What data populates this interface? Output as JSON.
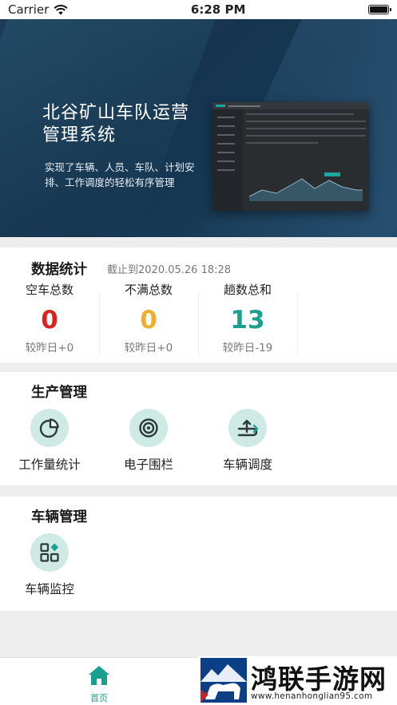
{
  "status_bar": {
    "carrier": "Carrier",
    "time": "6:28 PM"
  },
  "banner": {
    "title": "北谷矿山车队运营管理系统",
    "description": "实现了车辆、人员、车队、计划安排、工作调度的轻松有序管理"
  },
  "stats": {
    "title": "数据统计",
    "date": "截止到2020.05.26 18:28",
    "items": [
      {
        "label": "空车总数",
        "value": "0",
        "sub": "较昨日+0",
        "color": "#d9231f"
      },
      {
        "label": "不满总数",
        "value": "0",
        "sub": "较昨日+0",
        "color": "#f0ac2e"
      },
      {
        "label": "趟数总和",
        "value": "13",
        "sub": "较昨日-19",
        "color": "#1aa08f"
      }
    ]
  },
  "production": {
    "title": "生产管理",
    "items": [
      {
        "label": "工作量统计",
        "icon": "pie-chart-icon"
      },
      {
        "label": "电子围栏",
        "icon": "fence-icon"
      },
      {
        "label": "车辆调度",
        "icon": "dispatch-icon"
      }
    ]
  },
  "vehicle": {
    "title": "车辆管理",
    "items": [
      {
        "label": "车辆监控",
        "icon": "monitor-icon"
      }
    ]
  },
  "tabbar": {
    "home_label": "首页"
  },
  "watermark": {
    "brand": "鸿联手游网",
    "url": "www.henanhonglian95.com"
  },
  "colors": {
    "accent": "#1a9f93",
    "icon_bg": "#cfe9e5"
  }
}
